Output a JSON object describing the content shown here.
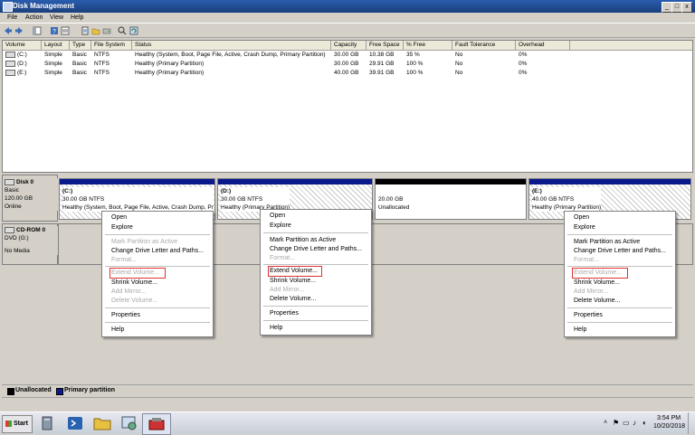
{
  "window": {
    "title": "Disk Management",
    "min": "_",
    "max": "□",
    "close": "x"
  },
  "menu": [
    "File",
    "Action",
    "View",
    "Help"
  ],
  "table": {
    "headers": [
      "Volume",
      "Layout",
      "Type",
      "File System",
      "Status",
      "Capacity",
      "Free Space",
      "% Free",
      "Fault Tolerance",
      "Overhead"
    ],
    "rows": [
      [
        "(C:)",
        "Simple",
        "Basic",
        "NTFS",
        "Healthy (System, Boot, Page File, Active, Crash Dump, Primary Partition)",
        "30.00 GB",
        "10.38 GB",
        "35 %",
        "No",
        "0%"
      ],
      [
        "(D:)",
        "Simple",
        "Basic",
        "NTFS",
        "Healthy (Primary Partition)",
        "30.00 GB",
        "29.91 GB",
        "100 %",
        "No",
        "0%"
      ],
      [
        "(E:)",
        "Simple",
        "Basic",
        "NTFS",
        "Healthy (Primary Partition)",
        "40.00 GB",
        "39.91 GB",
        "100 %",
        "No",
        "0%"
      ]
    ]
  },
  "disk0": {
    "name": "Disk 0",
    "type": "Basic",
    "size": "120.00 GB",
    "state": "Online"
  },
  "cdrom": {
    "name": "CD-ROM 0",
    "drive": "DVD (G:)",
    "media": "No Media"
  },
  "partitions": [
    {
      "label": "(C:)",
      "size": "30.00 GB NTFS",
      "status": "Healthy (System, Boot, Page File, Active, Crash Dump, Pr"
    },
    {
      "label": "(D:)",
      "size": "30.00 GB NTFS",
      "status": "Healthy (Primary Partition)"
    },
    {
      "label": "",
      "size": "20.00 GB",
      "status": "Unallocated"
    },
    {
      "label": "(E:)",
      "size": "40.00 GB NTFS",
      "status": "Healthy (Primary Partition)"
    }
  ],
  "context_menus": [
    [
      "Open",
      "Explore",
      "Mark Partition as Active",
      "Change Drive Letter and Paths...",
      "Format...",
      "Extend Volume...",
      "Shrink Volume...",
      "Add Mirror...",
      "Delete Volume...",
      "Properties",
      "Help"
    ],
    [
      "Open",
      "Explore",
      "Mark Partition as Active",
      "Change Drive Letter and Paths...",
      "Format...",
      "Extend Volume...",
      "Shrink Volume...",
      "Add Mirror...",
      "Delete Volume...",
      "Properties",
      "Help"
    ],
    [
      "Open",
      "Explore",
      "Mark Partition as Active",
      "Change Drive Letter and Paths...",
      "Format...",
      "Extend Volume...",
      "Shrink Volume...",
      "Add Mirror...",
      "Delete Volume...",
      "Properties",
      "Help"
    ]
  ],
  "legend": {
    "unallocated": "Unallocated",
    "primary": "Primary partition"
  },
  "taskbar": {
    "start": "Start",
    "time": "3:54 PM",
    "date": "10/20/2018"
  },
  "colors": {
    "titlebar": "#1b3f7c",
    "primary_partition": "#0a1a8c",
    "unallocated": "#000000",
    "highlight_box": "#dd3333"
  }
}
